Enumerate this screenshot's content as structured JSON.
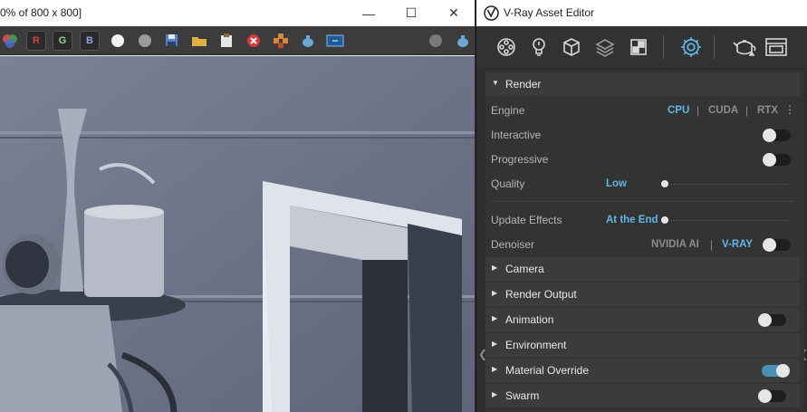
{
  "frame_buffer": {
    "title": "0% of 800 x 800]",
    "toolbar": {
      "channel_red": "R",
      "channel_green": "G",
      "channel_blue": "B"
    }
  },
  "asset_editor": {
    "title": "V-Ray Asset Editor",
    "tabs": [
      "geometry-icon",
      "light-icon",
      "cube-icon",
      "layers-icon",
      "texture-icon",
      "settings-gear-icon",
      "teapot-icon",
      "render-window-icon"
    ],
    "render": {
      "header": "Render",
      "engine_label": "Engine",
      "engine_options": [
        "CPU",
        "CUDA",
        "RTX"
      ],
      "engine_selected": "CPU",
      "interactive_label": "Interactive",
      "interactive_on": false,
      "progressive_label": "Progressive",
      "progressive_on": false,
      "quality_label": "Quality",
      "quality_value": "Low",
      "update_effects_label": "Update Effects",
      "update_effects_value": "At the End",
      "denoiser_label": "Denoiser",
      "denoiser_options": [
        "NVIDIA AI",
        "V-RAY"
      ],
      "denoiser_selected": "V-RAY",
      "denoiser_on": false
    },
    "sections": [
      {
        "label": "Camera",
        "has_toggle": false
      },
      {
        "label": "Render Output",
        "has_toggle": false
      },
      {
        "label": "Animation",
        "has_toggle": true,
        "on": false
      },
      {
        "label": "Environment",
        "has_toggle": false
      },
      {
        "label": "Material Override",
        "has_toggle": true,
        "on": true
      },
      {
        "label": "Swarm",
        "has_toggle": true,
        "on": false
      }
    ]
  },
  "colors": {
    "accent": "#5fb7e6",
    "panel_bg": "#333333",
    "header_bg": "#3b3b3b",
    "toggle_on": "#4a8fb6"
  }
}
